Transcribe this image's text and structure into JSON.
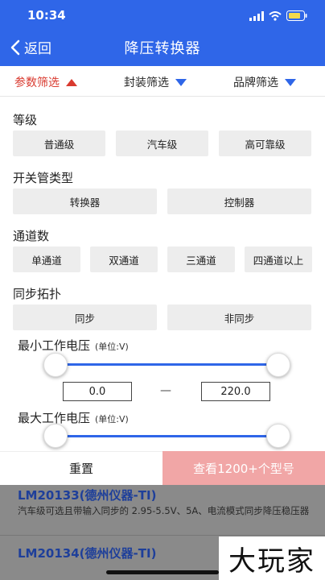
{
  "status_bar": {
    "time": "10:34"
  },
  "nav": {
    "back_label": "返回",
    "title": "降压转换器"
  },
  "filters": [
    {
      "label": "参数筛选",
      "state": "expanded"
    },
    {
      "label": "封装筛选",
      "state": "collapsed"
    },
    {
      "label": "品牌筛选",
      "state": "collapsed"
    }
  ],
  "sections": {
    "grade": {
      "label": "等级",
      "options": [
        "普通级",
        "汽车级",
        "高可靠级"
      ]
    },
    "switch_type": {
      "label": "开关管类型",
      "options": [
        "转换器",
        "控制器"
      ]
    },
    "channels": {
      "label": "通道数",
      "options": [
        "单通道",
        "双通道",
        "三通道",
        "四通道以上"
      ]
    },
    "sync": {
      "label": "同步拓扑",
      "options": [
        "同步",
        "非同步"
      ]
    }
  },
  "min_voltage": {
    "label": "最小工作电压",
    "unit": "(单位:V)",
    "min_value": "0.0",
    "max_value": "220.0",
    "separator": "—"
  },
  "max_voltage": {
    "label": "最大工作电压",
    "unit": "(单位:V)"
  },
  "actions": {
    "reset_label": "重置",
    "view_label": "查看1200+个型号"
  },
  "results": [
    {
      "name": "LM20133(德州仪器-TI)",
      "desc": "汽车级可选且带输入同步的 2.95-5.5V、5A、电流模式同步降压稳压器"
    },
    {
      "name": "LM20134(德州仪器-TI)",
      "desc": ""
    }
  ],
  "watermark": "大玩家",
  "colors": {
    "primary": "#2f66e8",
    "active_filter": "#d93a2f",
    "view_button": "#f1a6a6"
  }
}
